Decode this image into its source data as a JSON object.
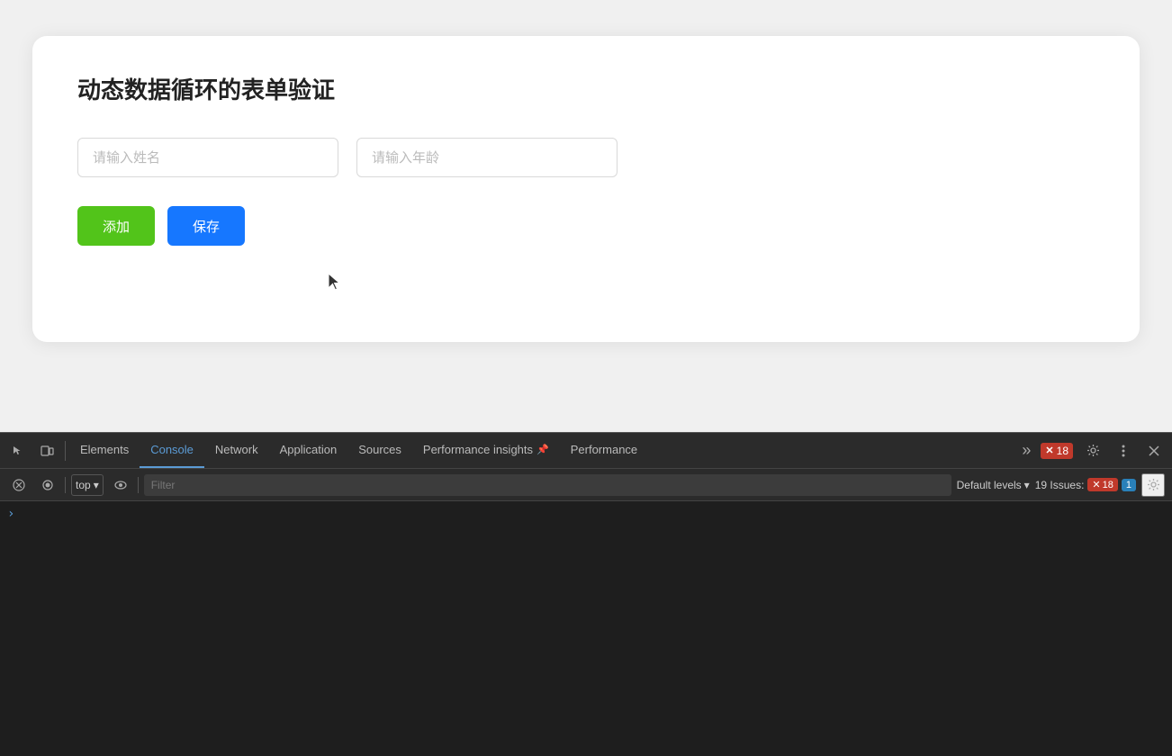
{
  "app": {
    "title": "动态数据循环的表单验证"
  },
  "form": {
    "name_placeholder": "请输入姓名",
    "age_placeholder": "请输入年龄",
    "add_label": "添加",
    "save_label": "保存"
  },
  "devtools": {
    "tabs": [
      {
        "id": "elements",
        "label": "Elements",
        "active": false
      },
      {
        "id": "console",
        "label": "Console",
        "active": true
      },
      {
        "id": "network",
        "label": "Network",
        "active": false
      },
      {
        "id": "application",
        "label": "Application",
        "active": false
      },
      {
        "id": "sources",
        "label": "Sources",
        "active": false
      },
      {
        "id": "performance-insights",
        "label": "Performance insights",
        "active": false
      },
      {
        "id": "performance",
        "label": "Performance",
        "active": false
      }
    ],
    "error_count": "18",
    "top_selector": "top",
    "filter_placeholder": "Filter",
    "default_levels_label": "Default levels",
    "issues_label": "19 Issues:",
    "issues_error_count": "18",
    "issues_info_count": "1"
  }
}
